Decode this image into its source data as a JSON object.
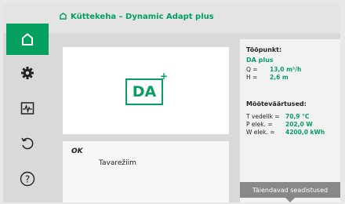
{
  "header": {
    "title": "Küttekeha – Dynamic Adapt plus",
    "icon": "home-icon"
  },
  "sidebar": {
    "items": [
      {
        "name": "home",
        "icon": "home-icon",
        "active": true
      },
      {
        "name": "settings",
        "icon": "gear-icon",
        "active": false
      },
      {
        "name": "diagnostics",
        "icon": "pulse-monitor-icon",
        "active": false
      },
      {
        "name": "restore",
        "icon": "undo-icon",
        "active": false
      },
      {
        "name": "help",
        "icon": "help-icon",
        "active": false
      }
    ]
  },
  "mode_tile": {
    "label": "DA",
    "plus": "+"
  },
  "status": {
    "state": "OK",
    "mode": "Tavarežiim"
  },
  "operating_point": {
    "title": "Tööpunkt:",
    "mode": "DA plus",
    "q_label": "Q =",
    "q_value": "13,0 m³/h",
    "h_label": "H =",
    "h_value": "2,6 m"
  },
  "measurements": {
    "title": "Mõõteväärtused:",
    "rows": [
      {
        "label": "T vedelik =",
        "value": "70,9 °C"
      },
      {
        "label": "P elek. =",
        "value": "202,0 W"
      },
      {
        "label": "W elek. =",
        "value": "4200,0 kWh"
      }
    ]
  },
  "more_settings": {
    "label": "Täiendavad seadistused"
  },
  "colors": {
    "accent": "#05a060",
    "panel": "#f7f7f7",
    "background": "#d9d9d9",
    "button": "#888888"
  }
}
